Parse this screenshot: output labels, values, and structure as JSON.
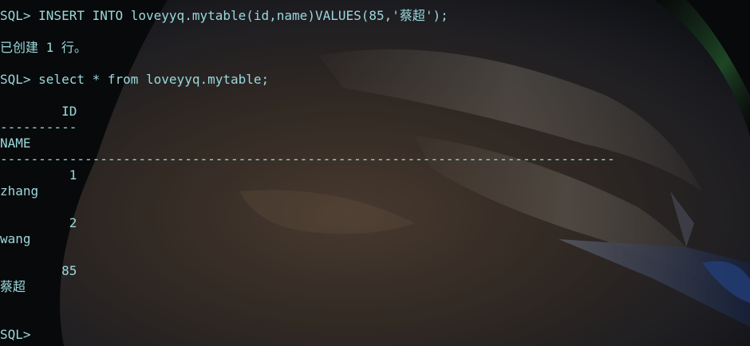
{
  "terminal": {
    "accent_color": "#9ad8dc",
    "lines": [
      "SQL> INSERT INTO loveyyq.mytable(id,name)VALUES(85,'蔡超');",
      "已创建 1 行。",
      "SQL> select * from loveyyq.mytable;",
      "        ID",
      "----------",
      "NAME",
      "--------------------------------------------------------------------------------",
      "         1",
      "zhang",
      "         2",
      "wang",
      "        85",
      "蔡超",
      "SQL>"
    ]
  }
}
